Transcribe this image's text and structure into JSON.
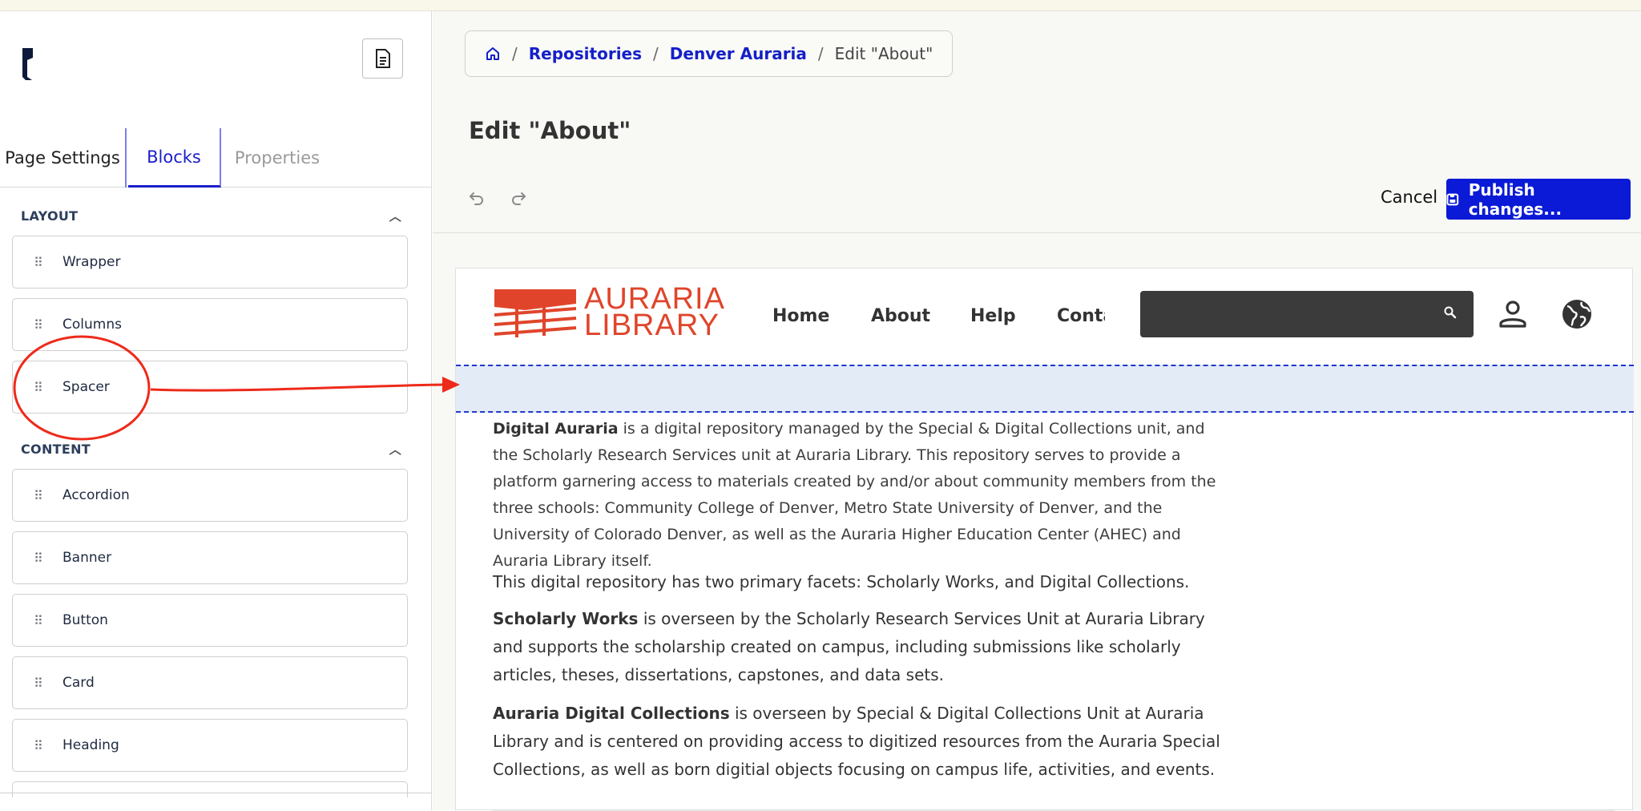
{
  "sidebar": {
    "tabs": [
      {
        "label": "Page Settings"
      },
      {
        "label": "Blocks"
      },
      {
        "label": "Properties"
      }
    ],
    "sections": [
      {
        "title": "LAYOUT",
        "items": [
          "Wrapper",
          "Columns",
          "Spacer"
        ]
      },
      {
        "title": "CONTENT",
        "items": [
          "Accordion",
          "Banner",
          "Button",
          "Card",
          "Heading"
        ]
      }
    ]
  },
  "breadcrumb": {
    "items": [
      "Repositories",
      "Denver Auraria"
    ],
    "separator": "/",
    "current": "Edit \"About\""
  },
  "page": {
    "title": "Edit \"About\""
  },
  "toolbar": {
    "cancel_label": "Cancel",
    "publish_label": "Publish changes..."
  },
  "preview": {
    "logo": {
      "line1": "AURARIA",
      "line2": "LIBRARY"
    },
    "nav": [
      "Home",
      "About",
      "Help",
      "Contact"
    ],
    "paragraphs": {
      "p1_bold": "Digital Auraria",
      "p1_text": " is a digital repository managed by the Special & Digital Collections unit, and the Scholarly Research Services unit at Auraria Library. This repository serves to provide a platform garnering access to materials created by and/or about community members from the three schools: Community College of Denver, Metro State University of Denver, and the University of Colorado Denver, as well as the Auraria Higher Education Center (AHEC) and Auraria Library itself.",
      "p2_text": "This digital repository has two primary facets: Scholarly Works, and Digital Collections.",
      "p3_bold": "Scholarly Works",
      "p3_text": " is overseen by the Scholarly Research Services Unit at Auraria Library and supports the scholarship created on campus, including submissions like scholarly articles, theses, dissertations, capstones, and data sets.",
      "p4_bold": "Auraria Digital Collections",
      "p4_text": " is overseen by Special & Digital Collections Unit at Auraria Library and is centered on providing access to digitized resources from the Auraria Special Collections, as well as born digitial objects focusing on campus life, activities, and events."
    }
  },
  "colors": {
    "accent": "#0a1ad6",
    "link": "#1420c8",
    "logo": "#e0452b",
    "annotation": "#ee2a1a"
  },
  "icons": [
    "doc-icon",
    "home-icon",
    "undo-icon",
    "redo-icon",
    "save-icon",
    "search-icon",
    "user-icon",
    "globe-icon",
    "grip-icon",
    "chevron-up-icon"
  ]
}
